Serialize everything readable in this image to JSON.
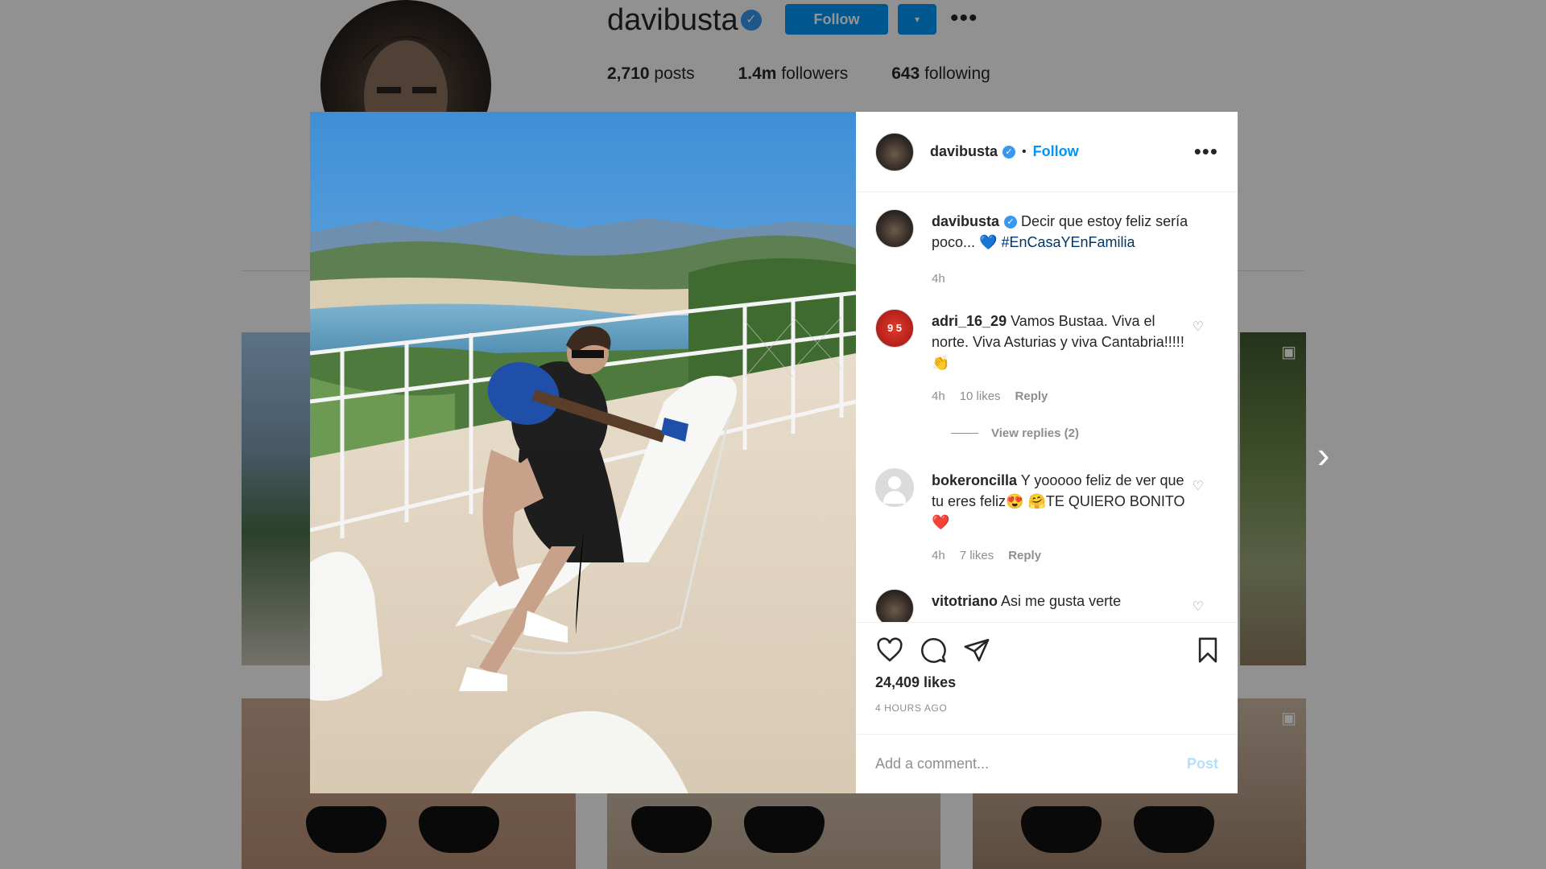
{
  "profile": {
    "username": "davibusta",
    "verified_icon": "verified-badge-icon",
    "follow_label": "Follow",
    "dropdown_icon": "▾",
    "more_icon": "•••",
    "stats": [
      {
        "value": "2,710",
        "label": "posts"
      },
      {
        "value": "1.4m",
        "label": "followers"
      },
      {
        "value": "643",
        "label": "following"
      }
    ]
  },
  "post": {
    "header": {
      "username": "davibusta",
      "separator": "•",
      "follow_label": "Follow",
      "more_icon": "•••"
    },
    "caption": {
      "username": "davibusta",
      "text": "Decir que estoy feliz sería poco... 💙",
      "hashtag": "#EnCasaYEnFamilia",
      "time": "4h"
    },
    "comments": [
      {
        "username": "adri_16_29",
        "avatar_text": "9 5",
        "text": "Vamos Bustaa. Viva el norte. Viva Asturias y viva Cantabria!!!!!👏",
        "time": "4h",
        "likes": "10 likes",
        "reply": "Reply",
        "view_replies": "View replies (2)"
      },
      {
        "username": "bokeroncilla",
        "text": "Y yooooo feliz de ver que tu eres feliz😍 🤗TE QUIERO BONITO❤️",
        "time": "4h",
        "likes": "7 likes",
        "reply": "Reply"
      },
      {
        "username": "vitotriano",
        "text": "Asi me gusta verte"
      }
    ],
    "likes": "24,409 likes",
    "posted_ago": "4 HOURS AGO",
    "comment_placeholder": "Add a comment...",
    "post_label": "Post"
  },
  "colors": {
    "accent": "#0095f6",
    "text": "#262626",
    "muted": "#8e8e8e",
    "post_disabled": "#b2dffc"
  }
}
